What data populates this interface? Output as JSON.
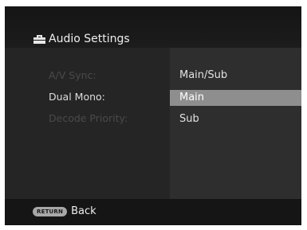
{
  "window": {
    "title": "Audio Settings",
    "title_icon": "toolbox-icon"
  },
  "menu": {
    "items": [
      {
        "label": "A/V Sync:",
        "state": "disabled"
      },
      {
        "label": "Dual Mono:",
        "state": "active"
      },
      {
        "label": "Decode Priority:",
        "state": "disabled"
      }
    ]
  },
  "options": {
    "items": [
      {
        "label": "Main/Sub",
        "selected": false
      },
      {
        "label": "Main",
        "selected": true
      },
      {
        "label": "Sub",
        "selected": false
      }
    ]
  },
  "footer": {
    "button_label": "RETURN",
    "action_label": "Back"
  },
  "colors": {
    "background": "#191919",
    "left_panel": "#252525",
    "right_panel": "#2e2e2e",
    "highlight": "#8e8e8e",
    "disabled_text": "#4a4a4a"
  }
}
